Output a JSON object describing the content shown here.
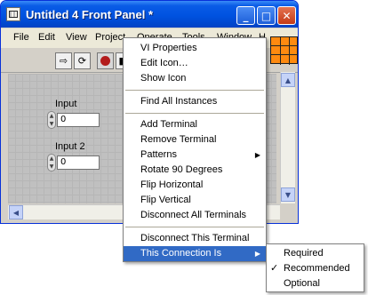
{
  "window": {
    "title": "Untitled 4 Front Panel *",
    "minimize_glyph": "_",
    "maximize_glyph": "□",
    "close_glyph": "✕"
  },
  "menubar": [
    "File",
    "Edit",
    "View",
    "Project",
    "Operate",
    "Tools",
    "Window",
    "H"
  ],
  "panel": {
    "input1_label": "Input",
    "input1_value": "0",
    "input2_label": "Input 2",
    "input2_value": "0"
  },
  "context_menu": {
    "items": [
      "VI Properties",
      "Edit Icon…",
      "Show Icon",
      "Find All Instances",
      "Add Terminal",
      "Remove Terminal",
      "Patterns",
      "Rotate 90 Degrees",
      "Flip Horizontal",
      "Flip Vertical",
      "Disconnect All Terminals",
      "Disconnect This Terminal",
      "This Connection Is"
    ]
  },
  "submenu": {
    "items": [
      "Required",
      "Recommended",
      "Optional"
    ],
    "checked": "Recommended"
  },
  "icons": [
    "labview-app-icon",
    "run-arrow-icon",
    "run-continuous-icon",
    "abort-icon",
    "pause-icon",
    "spinner-icon",
    "vi-connector-icon"
  ],
  "colors": {
    "highlight": "#316ac5",
    "title_bar": "#0052e0",
    "vi_icon": "#ff8a10"
  }
}
